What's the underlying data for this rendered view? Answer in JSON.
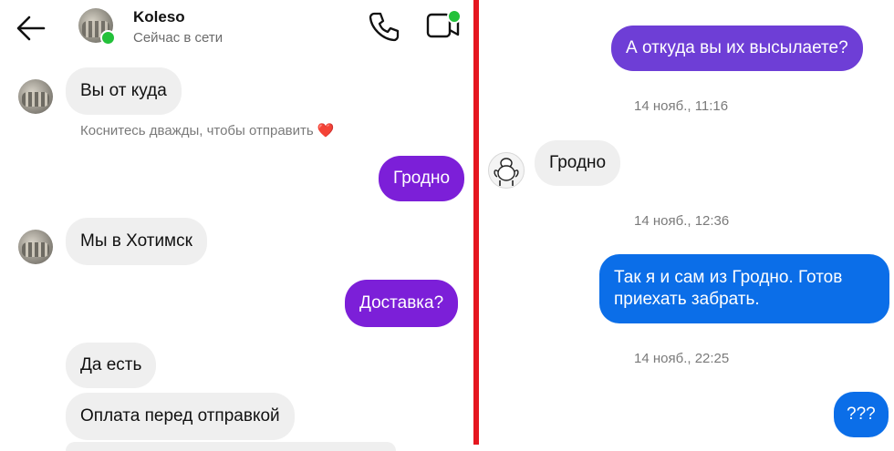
{
  "header": {
    "name": "Koleso",
    "status": "Сейчас в сети"
  },
  "left": {
    "messages": [
      {
        "dir": "in",
        "text": "Вы от куда"
      },
      {
        "dir": "out",
        "text": "Гродно"
      },
      {
        "dir": "in",
        "text": "Мы в Хотимск"
      },
      {
        "dir": "out",
        "text": "Доставка?"
      },
      {
        "dir": "in",
        "text": "Да есть"
      },
      {
        "dir": "in",
        "text": "Оплата перед отправкой"
      }
    ],
    "hint_text": "Коснитесь дважды, чтобы отправить",
    "hint_emoji": "❤️"
  },
  "right": {
    "messages": [
      {
        "dir": "out",
        "text": "А откуда вы их высылаете?"
      },
      {
        "dir": "in",
        "text": "Гродно"
      },
      {
        "dir": "out",
        "text": "Так я и сам из Гродно. Готов приехать забрать."
      },
      {
        "dir": "out",
        "text": "???"
      }
    ],
    "timestamps": [
      "14 нояб., 11:16",
      "14 нояб., 12:36",
      "14 нояб., 22:25"
    ]
  },
  "colors": {
    "purple_bubble": "#7c1fd8",
    "indigo_bubble": "#6e3ed6",
    "blue_bubble": "#0b6ee8",
    "incoming_bubble": "#efefef",
    "divider": "#e5161f",
    "online": "#23c13a"
  },
  "icons": [
    "back-arrow-icon",
    "phone-icon",
    "video-call-icon",
    "heart-icon"
  ]
}
